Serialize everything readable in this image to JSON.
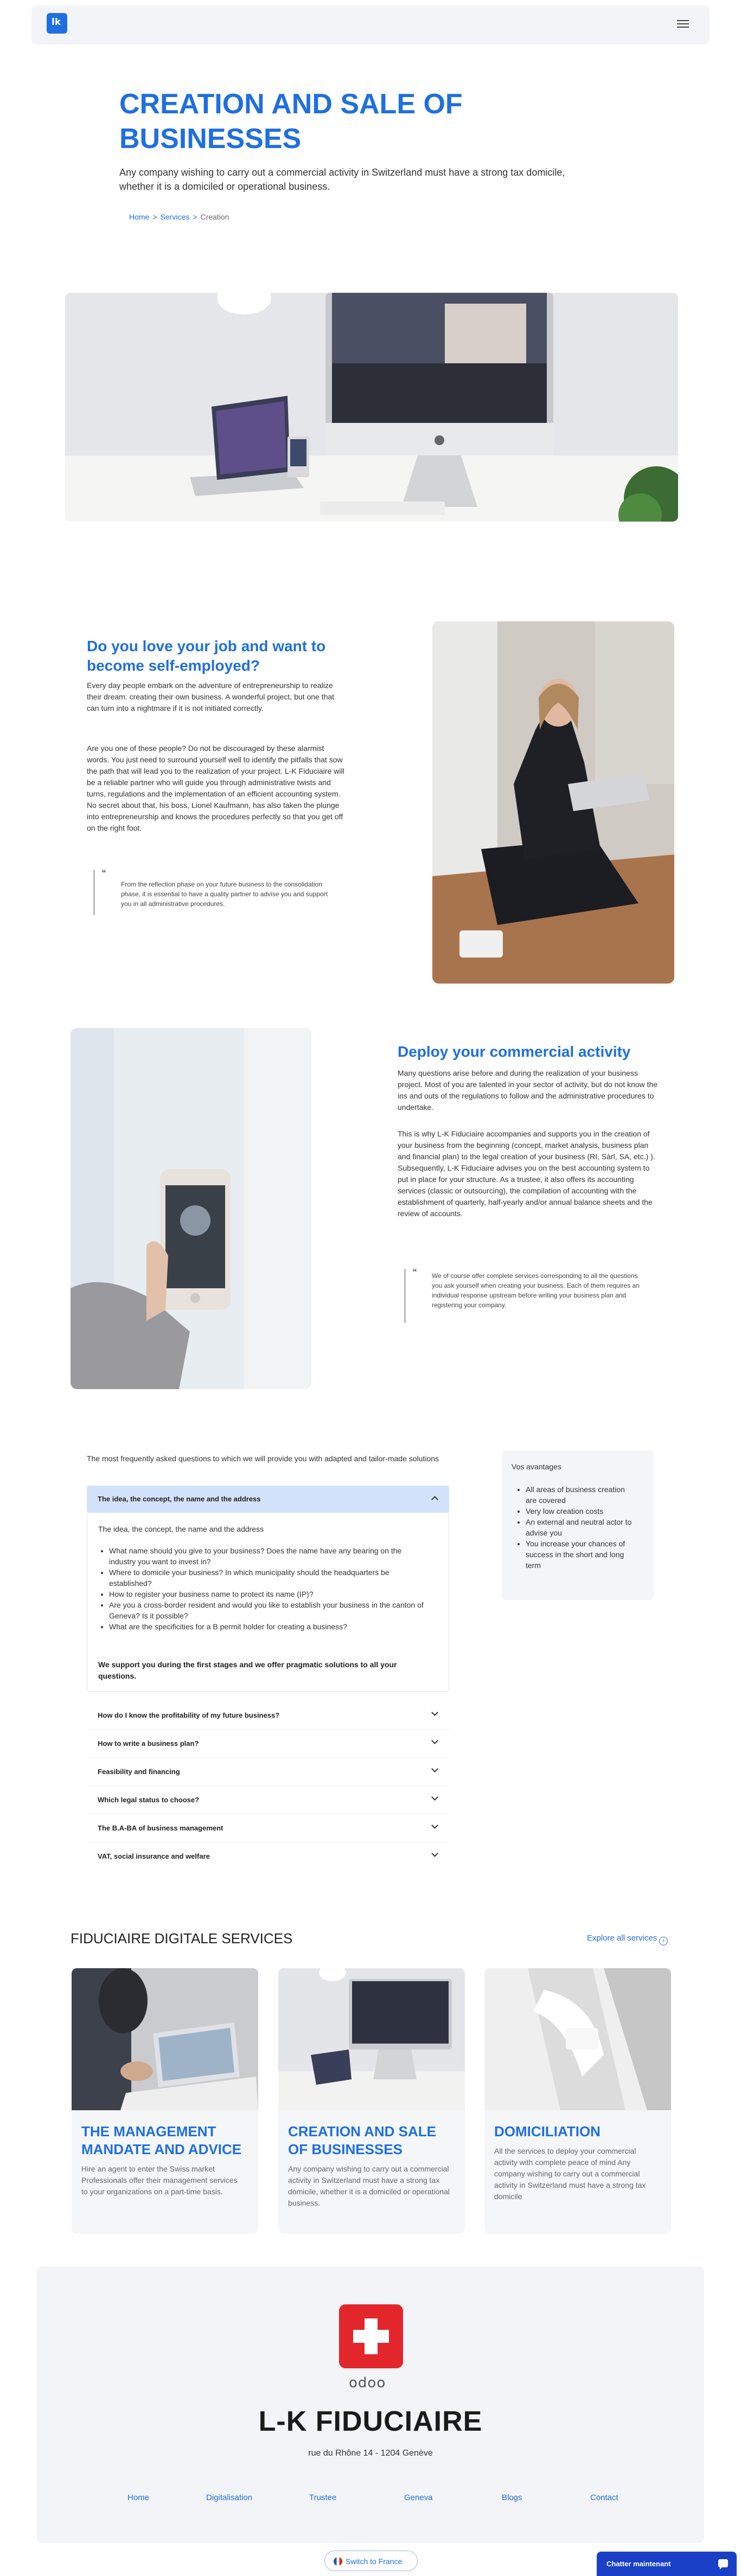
{
  "header": {
    "logo_text": "lk",
    "menu_icon": "hamburger-menu-icon"
  },
  "hero": {
    "title": "CREATION AND SALE OF BUSINESSES",
    "subtitle": "Any company wishing to carry out a commercial activity in Switzerland must have a strong tax domicile, whether it is a domiciled or operational business.",
    "breadcrumb": {
      "home": "Home",
      "services": "Services",
      "current": "Creation",
      "separator": ">"
    }
  },
  "section_self_employed": {
    "title": "Do you love your job and want to become self-employed?",
    "p1": "Every day people embark on the adventure of entrepreneurship to realize their dream: creating their own business. A wonderful project, but one that can turn into a nightmare if it is not initiated correctly.",
    "p2": "Are you one of these people? Do not be discouraged by these alarmist words. You just need to surround yourself well to identify the pitfalls that sow the path that will lead you to the realization of your project. L-K Fiduciaire will be a reliable partner who will guide you through administrative twists and turns, regulations and the implementation of an efficient accounting system. No secret about that, his boss, Lionel Kaufmann, has also taken the plunge into entrepreneurship and knows the procedures perfectly so that you get off on the right foot.",
    "quote": "From the reflection phase on your future business to the consolidation phase, it is essential to have a quality partner to advise you and support you in all administrative procedures."
  },
  "section_deploy": {
    "title": "Deploy your commercial activity",
    "p1": "Many questions arise before and during the realization of your business project. Most of you are talented in your sector of activity, but do not know the ins and outs of the regulations to follow and the administrative procedures to undertake.",
    "p2": "This is why L-K Fiduciaire accompanies and supports you in the creation of your business from the beginning (concept, market analysis, business plan and financial plan) to the legal creation of your business (RI, Sàrl, SA, etc.) ). Subsequently, L-K Fiduciaire advises you on the best accounting system to put in place for your structure. As a trustee, it also offers its accounting services (classic or outsourcing), the compilation of accounting with the establishment of quarterly, half-yearly and/or annual balance sheets and the review of accounts.",
    "quote": "We of course offer complete services corresponding to all the questions you ask yourself when creating your business. Each of them requires an individual response upstream before writing your business plan and registering your company."
  },
  "faq": {
    "intro": "The most frequently asked questions to which we will provide you with adapted and tailor-made solutions",
    "open_item": {
      "title": "The idea, the concept, the name and the address",
      "lead": "The idea, the concept, the name and the address",
      "bullets": [
        "What name should you give to your business? Does the name have any bearing on the industry you want to invest in?",
        "Where to domicile your business? In which municipality should the headquarters be established?",
        "How to register your business name to protect its name (IP)?",
        "Are you a cross-border resident and would you like to establish your business in the canton of Geneva? Is it possible?",
        "What are the specificities for a B permit holder for creating a business?"
      ],
      "closing": "We support you during the first stages and we offer pragmatic solutions to all your questions."
    },
    "items": [
      "How do I know the profitability of my future business?",
      "How to write a business plan?",
      "Feasibility and financing",
      "Which legal status to choose?",
      "The B.A-BA of business management",
      "VAT, social insurance and welfare"
    ]
  },
  "advantages": {
    "title": "Vos avantages",
    "items": [
      "All areas of business creation are covered",
      "Very low creation costs",
      "An external and neutral actor to advise you",
      "You increase your chances of success in the short and long term"
    ]
  },
  "services": {
    "title": "FIDUCIAIRE DIGITALE SERVICES",
    "explore": "Explore all services",
    "cards": [
      {
        "title": "THE MANAGEMENT MANDATE AND ADVICE",
        "desc": "Hire an agent to enter the Swiss market Professionals offer their management services to your organizations on a part-time basis."
      },
      {
        "title": "CREATION AND SALE OF BUSINESSES",
        "desc": "Any company wishing to carry out a commercial activity in Switzerland must have a strong tax domicile, whether it is a domiciled or operational business."
      },
      {
        "title": "DOMICILIATION",
        "desc": "All the services to deploy your commercial activity with complete peace of mind Any company wishing to carry out a commercial activity in Switzerland must have a strong tax domicile"
      }
    ]
  },
  "footer": {
    "odoo": "odoo",
    "brand": "L-K FIDUCIAIRE",
    "address": "rue du Rhône 14 - 1204 Genève",
    "nav": [
      "Home",
      "Digitalisation",
      "Trustee",
      "Geneva",
      "Blogs",
      "Contact"
    ]
  },
  "widgets": {
    "lang_label": "Switch to France",
    "chat_label": "Chatter maintenant"
  },
  "colors": {
    "accent": "#1f6fe0",
    "chat": "#1a40c8",
    "swiss_red": "#e3262b"
  }
}
